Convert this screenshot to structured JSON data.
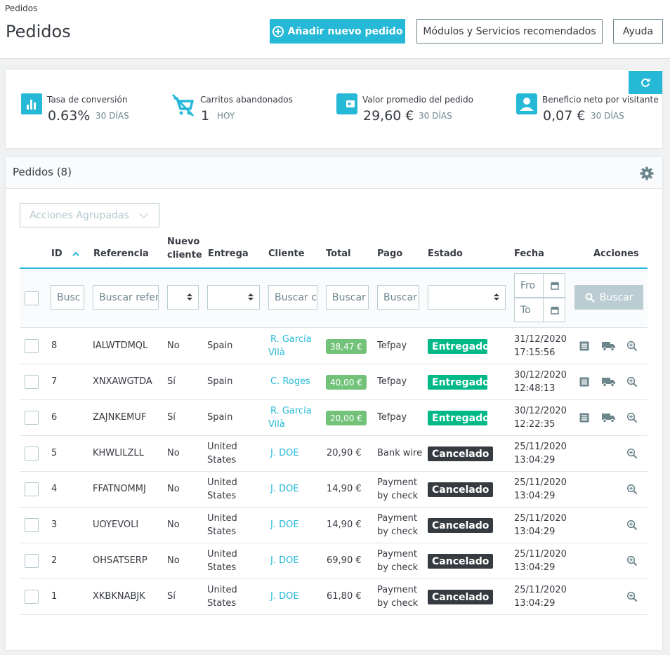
{
  "header": {
    "breadcrumb": "Pedidos",
    "title": "Pedidos",
    "add_order_label": "Añadir nuevo pedido",
    "modules_label": "Módulos y Servicios recomendados",
    "help_label": "Ayuda"
  },
  "kpis": [
    {
      "label": "Tasa de conversión",
      "value": "0.63%",
      "period": "30 DÍAS",
      "icon": "bar-chart-icon"
    },
    {
      "label": "Carritos abandonados",
      "value": "1",
      "period": "HOY",
      "icon": "cart-off-icon"
    },
    {
      "label": "Valor promedio del pedido",
      "value": "29,60 €",
      "period": "30 DÍAS",
      "icon": "wallet-icon"
    },
    {
      "label": "Beneficio neto por visitante",
      "value": "0,07 €",
      "period": "30 DÍAS",
      "icon": "user-icon"
    }
  ],
  "orders": {
    "title": "Pedidos (8)",
    "bulk_actions_label": "Acciones Agrupadas",
    "columns": {
      "id": "ID",
      "reference": "Referencia",
      "new_client_1": "Nuevo",
      "new_client_2": "cliente",
      "delivery": "Entrega",
      "customer": "Cliente",
      "total": "Total",
      "payment": "Pago",
      "status": "Estado",
      "date": "Fecha",
      "actions": "Acciones"
    },
    "filters": {
      "id_placeholder": "Busc",
      "reference_placeholder": "Buscar refer",
      "customer_placeholder": "Buscar c",
      "total_placeholder": "Buscar",
      "payment_placeholder": "Buscar",
      "date_from_placeholder": "Fro",
      "date_to_placeholder": "To",
      "search_label": "Buscar"
    },
    "rows": [
      {
        "id": "8",
        "reference": "IALWTDMQL",
        "new_client": "No",
        "delivery_1": "Spain",
        "delivery_2": "",
        "customer_1": "R. García",
        "customer_2": "Vilà",
        "total": "38,47 €",
        "payment_1": "Tefpay",
        "payment_2": "",
        "status": "Entregado",
        "date": "31/12/2020",
        "time": "17:15:56"
      },
      {
        "id": "7",
        "reference": "XNXAWGTDA",
        "new_client": "Sí",
        "delivery_1": "Spain",
        "delivery_2": "",
        "customer_1": "C. Roges",
        "customer_2": "",
        "total": "40,00 €",
        "payment_1": "Tefpay",
        "payment_2": "",
        "status": "Entregado",
        "date": "30/12/2020",
        "time": "12:48:13"
      },
      {
        "id": "6",
        "reference": "ZAJNKEMUF",
        "new_client": "Sí",
        "delivery_1": "Spain",
        "delivery_2": "",
        "customer_1": "R. García",
        "customer_2": "Vilà",
        "total": "20,00 €",
        "payment_1": "Tefpay",
        "payment_2": "",
        "status": "Entregado",
        "date": "30/12/2020",
        "time": "12:22:35"
      },
      {
        "id": "5",
        "reference": "KHWLILZLL",
        "new_client": "No",
        "delivery_1": "United",
        "delivery_2": "States",
        "customer_1": "J. DOE",
        "customer_2": "",
        "total": "20,90 €",
        "payment_1": "Bank wire",
        "payment_2": "",
        "status": "Cancelado",
        "date": "25/11/2020",
        "time": "13:04:29"
      },
      {
        "id": "4",
        "reference": "FFATNOMMJ",
        "new_client": "No",
        "delivery_1": "United",
        "delivery_2": "States",
        "customer_1": "J. DOE",
        "customer_2": "",
        "total": "14,90 €",
        "payment_1": "Payment",
        "payment_2": "by check",
        "status": "Cancelado",
        "date": "25/11/2020",
        "time": "13:04:29"
      },
      {
        "id": "3",
        "reference": "UOYEVOLI",
        "new_client": "No",
        "delivery_1": "United",
        "delivery_2": "States",
        "customer_1": "J. DOE",
        "customer_2": "",
        "total": "14,90 €",
        "payment_1": "Payment",
        "payment_2": "by check",
        "status": "Cancelado",
        "date": "25/11/2020",
        "time": "13:04:29"
      },
      {
        "id": "2",
        "reference": "OHSATSERP",
        "new_client": "No",
        "delivery_1": "United",
        "delivery_2": "States",
        "customer_1": "J. DOE",
        "customer_2": "",
        "total": "69,90 €",
        "payment_1": "Payment",
        "payment_2": "by check",
        "status": "Cancelado",
        "date": "25/11/2020",
        "time": "13:04:29"
      },
      {
        "id": "1",
        "reference": "XKBKNABJK",
        "new_client": "Sí",
        "delivery_1": "United",
        "delivery_2": "States",
        "customer_1": "J. DOE",
        "customer_2": "",
        "total": "61,80 €",
        "payment_1": "Payment",
        "payment_2": "by check",
        "status": "Cancelado",
        "date": "25/11/2020",
        "time": "13:04:29"
      }
    ]
  },
  "colors": {
    "accent": "#25b9d7",
    "delivered": "#01b887",
    "cancelled": "#363a41",
    "paid_total": "#72c279"
  }
}
